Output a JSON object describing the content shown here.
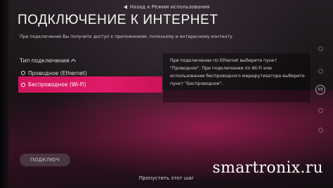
{
  "header": {
    "back_label": "Назад к Режим использования",
    "title": "ПОДКЛЮЧЕНИЕ К ИНТЕРНЕТ",
    "subtitle": "При подключении Вы получите доступ к приложениям, полезному и интересному контенту."
  },
  "network": {
    "section_label": "Тип подключения",
    "options": [
      {
        "label": "Проводное (Ethernet)",
        "selected": false
      },
      {
        "label": "Беспроводное (Wi-Fi)",
        "selected": true
      }
    ]
  },
  "info": {
    "lines": [
      "При подключении по Ethernet выберите пункт",
      "\"Проводное\".  При подключении по Wi-Fi или",
      "использовании беспроводного маршрутизатора выберите",
      "пункт \"Беспроводное\"."
    ]
  },
  "steps": {
    "current": "03"
  },
  "actions": {
    "connect_label": "ПОДКЛЮЧ",
    "skip_label": "Пропустить этот шаг"
  },
  "watermark": "smartronix.ru",
  "icons": {
    "back": "back-arrow-icon",
    "expand": "chevron-up-icon",
    "radio": "radio-icon"
  },
  "colors": {
    "accent": "#e01a68",
    "background": "#171216"
  }
}
